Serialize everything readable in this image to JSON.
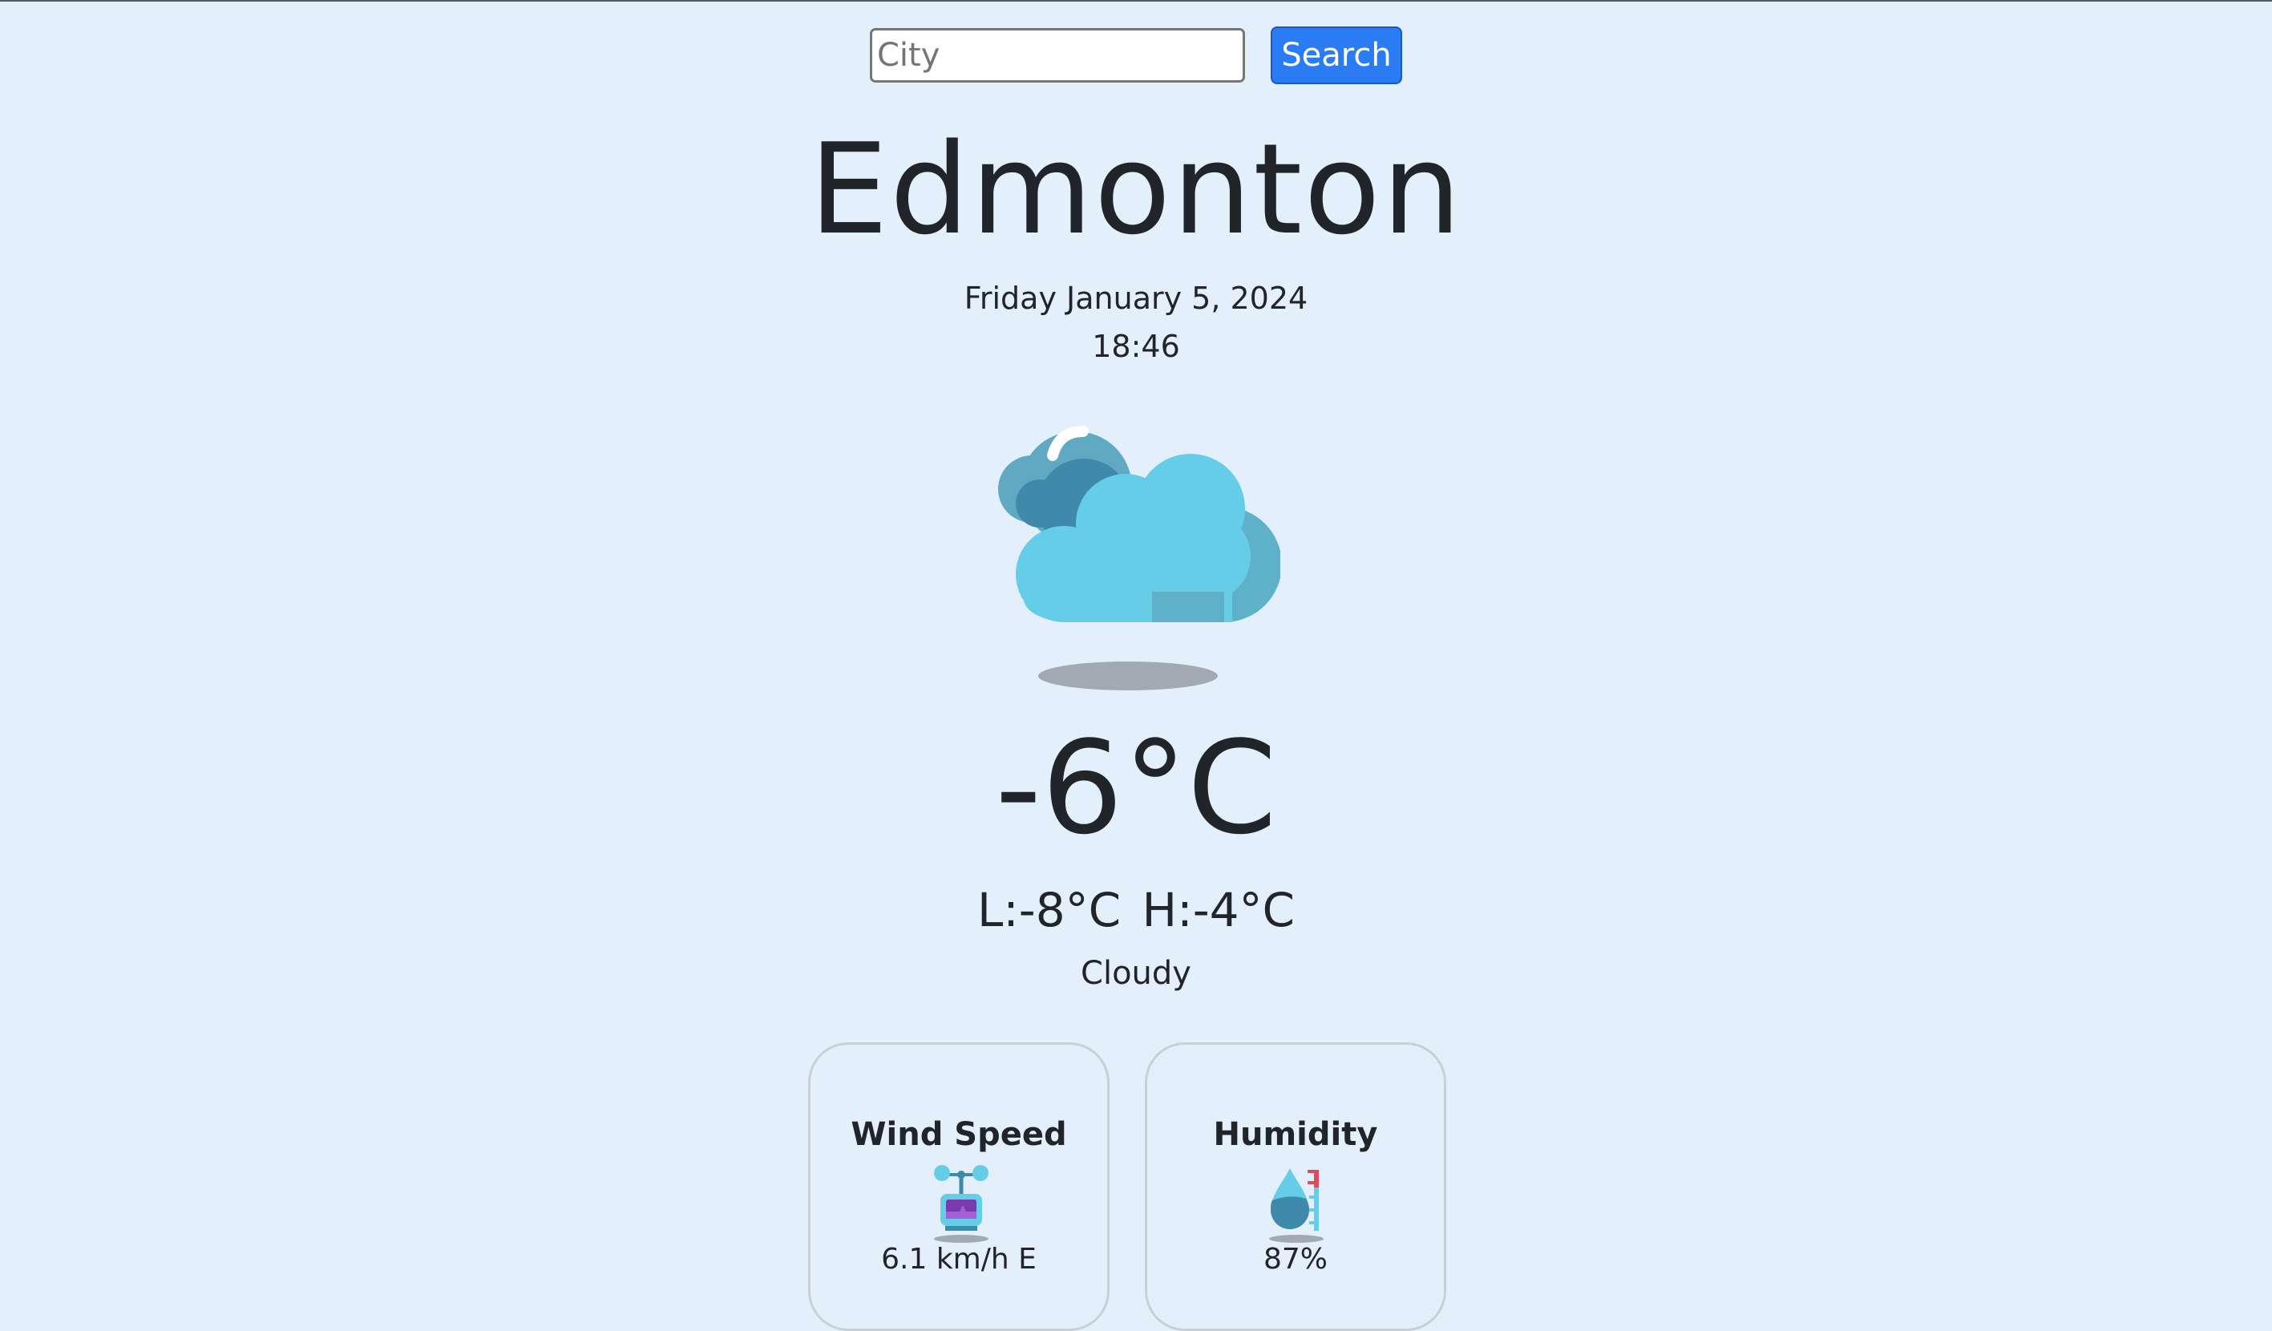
{
  "search": {
    "placeholder": "City",
    "value": "",
    "button_label": "Search"
  },
  "location": {
    "city": "Edmonton",
    "date": "Friday January 5, 2024",
    "time": "18:46"
  },
  "weather": {
    "icon": "cloudy-icon",
    "temperature": "-6°C",
    "low_high": "L:-8°C  H:-4°C",
    "condition": "Cloudy"
  },
  "cards": {
    "wind": {
      "title": "Wind Speed",
      "icon": "anemometer-icon",
      "value": "6.1 km/h E"
    },
    "humidity": {
      "title": "Humidity",
      "icon": "humidity-drop-icon",
      "value": "87%"
    }
  },
  "colors": {
    "background": "#e3f0fc",
    "button": "#2b7bf3",
    "text": "#212529",
    "cloud_front": "#66cde9",
    "cloud_back": "#3e8aa9"
  }
}
